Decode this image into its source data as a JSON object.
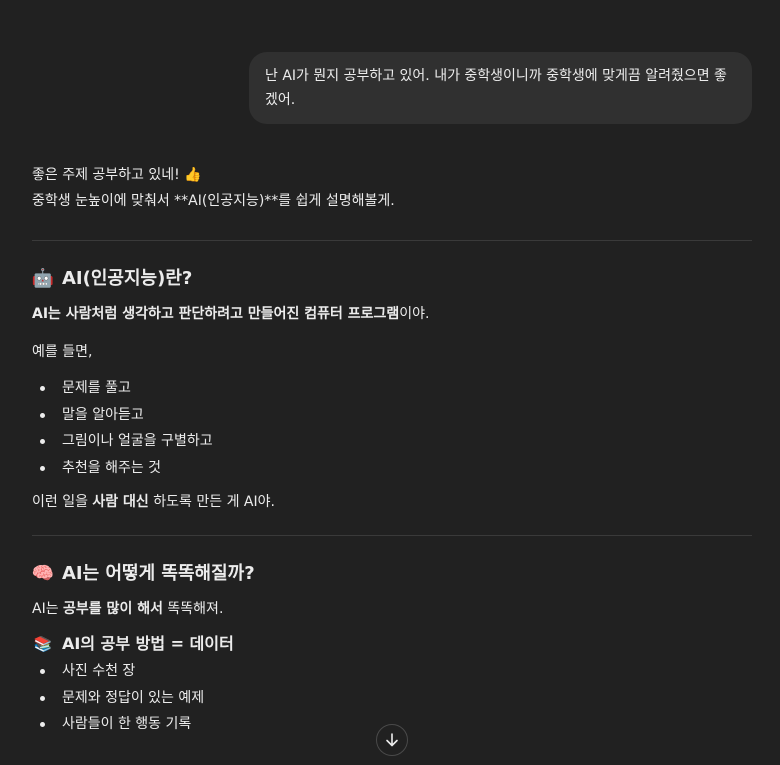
{
  "user_message": "난 AI가 뭔지 공부하고 있어. 내가 중학생이니까 중학생에 맞게끔 알려줬으면 좋겠어.",
  "intro": {
    "line1": "좋은 주제 공부하고 있네!",
    "line1_emoji": "👍",
    "line2": "중학생 눈높이에 맞춰서 **AI(인공지능)**를 쉽게 설명해볼게."
  },
  "section1": {
    "emoji": "🤖",
    "title": "AI(인공지능)란?",
    "definition_bold": "AI는 사람처럼 생각하고 판단하려고 만들어진 컴퓨터 프로그램",
    "definition_tail": "이야.",
    "example_lead": "예를 들면,",
    "examples": [
      "문제를 풀고",
      "말을 알아듣고",
      "그림이나 얼굴을 구별하고",
      "추천을 해주는 것"
    ],
    "summary_pre": "이런 일을 ",
    "summary_bold": "사람 대신",
    "summary_post": " 하도록 만든 게 AI야."
  },
  "section2": {
    "emoji": "🧠",
    "title": "AI는 어떻게 똑똑해질까?",
    "lead_pre": "AI는 ",
    "lead_bold": "공부를 많이 해서",
    "lead_post": " 똑똑해져.",
    "sub_emoji": "📚",
    "sub_title": "AI의 공부 방법 = 데이터",
    "items": [
      "사진 수천 장",
      "문제와 정답이 있는 예제",
      "사람들이 한 행동 기록"
    ]
  },
  "scroll_button_icon": "arrow-down-icon"
}
